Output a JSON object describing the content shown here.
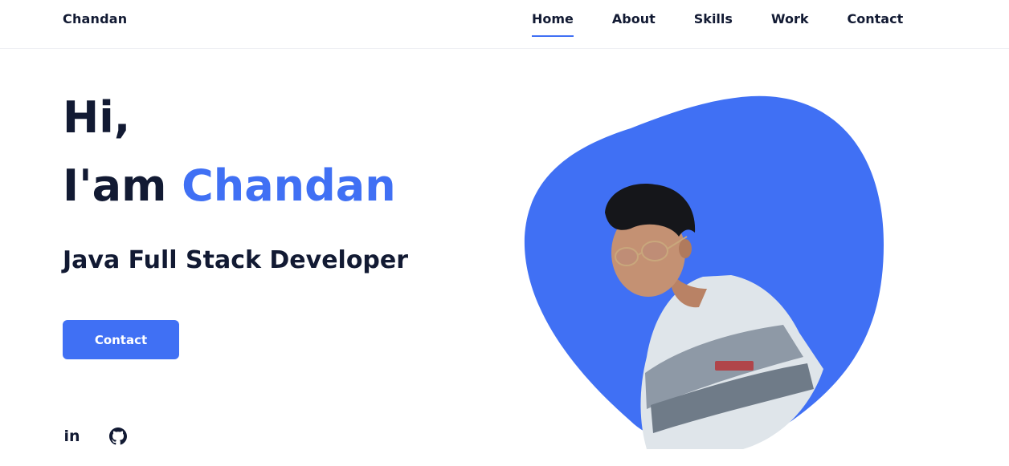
{
  "header": {
    "logo": "Chandan",
    "nav": [
      {
        "label": "Home",
        "active": true
      },
      {
        "label": "About",
        "active": false
      },
      {
        "label": "Skills",
        "active": false
      },
      {
        "label": "Work",
        "active": false
      },
      {
        "label": "Contact",
        "active": false
      }
    ]
  },
  "hero": {
    "greeting": "Hi,",
    "intro_prefix": "I'am",
    "intro_name": "Chandan",
    "role": "Java Full Stack Developer",
    "cta_label": "Contact",
    "social": [
      {
        "icon": "linkedin-icon",
        "glyph": "in"
      },
      {
        "icon": "github-icon"
      }
    ]
  },
  "colors": {
    "accent": "#4070f4",
    "text": "#121a33",
    "background": "#ffffff"
  }
}
